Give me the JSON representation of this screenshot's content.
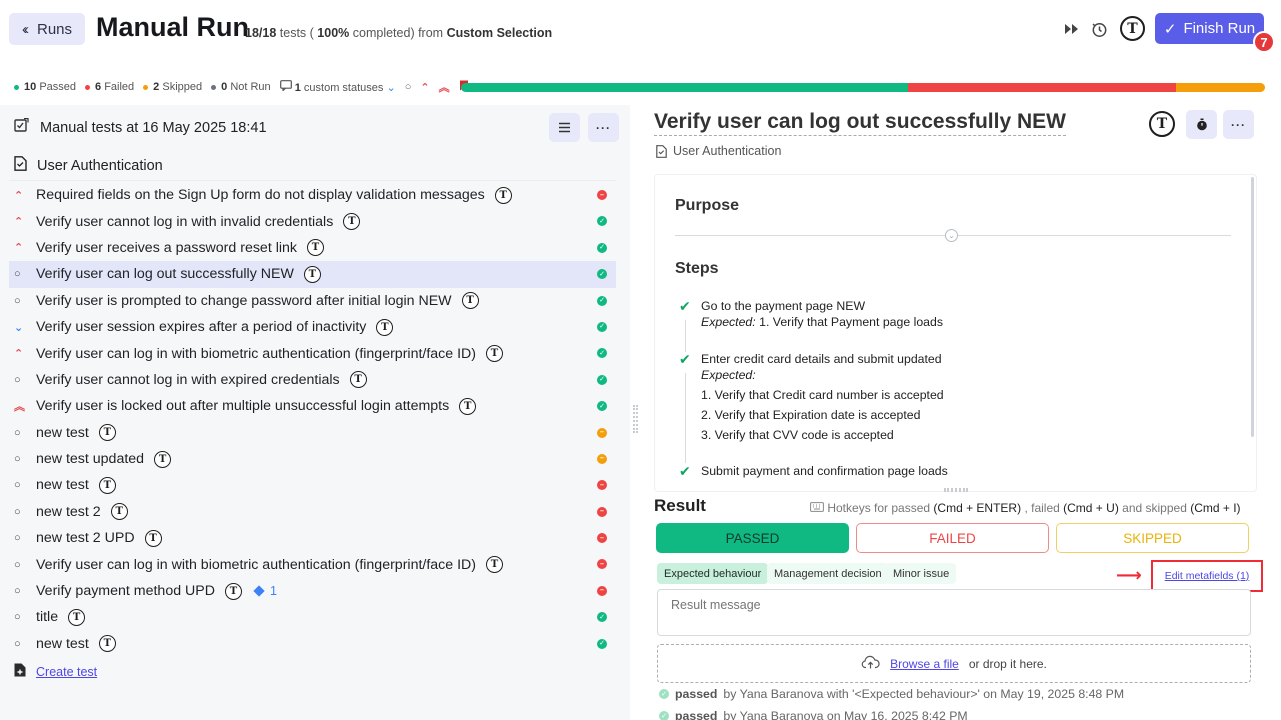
{
  "header": {
    "runs_label": "Runs",
    "title": "Manual Run",
    "count": "18/18",
    "tests_word": "tests (",
    "percent": "100%",
    "completed_from": "completed) from",
    "selection": "Custom Selection",
    "finish_label": "Finish Run",
    "notification_count": "7"
  },
  "stats": {
    "passed_count": "10",
    "passed_label": "Passed",
    "failed_count": "6",
    "failed_label": "Failed",
    "skipped_count": "2",
    "skipped_label": "Skipped",
    "notrun_count": "0",
    "notrun_label": "Not Run",
    "custom_count": "1",
    "custom_label": "custom statuses",
    "progress": {
      "passed": 10,
      "failed": 6,
      "skipped": 2,
      "not_run": 0
    }
  },
  "colors": {
    "passed": "#10b981",
    "failed": "#ef4444",
    "skipped": "#f59e0b",
    "notrun": "#6b7280",
    "accent": "#5a5de8"
  },
  "left": {
    "plan_title": "Manual tests at 16 May 2025 18:41",
    "suite_title": "User Authentication",
    "create_label": "Create test",
    "tests": [
      {
        "title": "Required fields on the Sign Up form do not display validation messages",
        "priority": "up",
        "status": "failed"
      },
      {
        "title": "Verify user cannot log in with invalid credentials",
        "priority": "up",
        "status": "passed"
      },
      {
        "title": "Verify user receives a password reset link",
        "priority": "up",
        "status": "passed"
      },
      {
        "title": "Verify user can log out successfully NEW",
        "priority": "none",
        "status": "passed",
        "active": true
      },
      {
        "title": "Verify user is prompted to change password after initial login NEW",
        "priority": "none",
        "status": "passed"
      },
      {
        "title": "Verify user session expires after a period of inactivity",
        "priority": "down",
        "status": "passed"
      },
      {
        "title": "Verify user can log in with biometric authentication (fingerprint/face ID)",
        "priority": "up",
        "status": "passed"
      },
      {
        "title": "Verify user cannot log in with expired credentials",
        "priority": "none",
        "status": "passed"
      },
      {
        "title": "Verify user is locked out after multiple unsuccessful login attempts",
        "priority": "dbl",
        "status": "passed"
      },
      {
        "title": "new test",
        "priority": "none",
        "status": "skipped"
      },
      {
        "title": "new test updated",
        "priority": "none",
        "status": "skipped"
      },
      {
        "title": "new test",
        "priority": "none",
        "status": "failed"
      },
      {
        "title": "new test 2",
        "priority": "none",
        "status": "failed"
      },
      {
        "title": "new test 2 UPD",
        "priority": "none",
        "status": "failed"
      },
      {
        "title": "Verify user can log in with biometric authentication (fingerprint/face ID)",
        "priority": "none",
        "status": "failed"
      },
      {
        "title": "Verify payment method UPD",
        "priority": "none",
        "status": "failed",
        "diamond": "1"
      },
      {
        "title": "title",
        "priority": "none",
        "status": "passed"
      },
      {
        "title": "new test",
        "priority": "none",
        "status": "passed"
      }
    ]
  },
  "detail": {
    "title": "Verify user can log out successfully NEW",
    "suite": "User Authentication",
    "purpose_label": "Purpose",
    "steps_label": "Steps",
    "expected_label": "Expected:",
    "step1": "Go to the payment page NEW",
    "step1_expected": "1. Verify that Payment page loads",
    "step2": "Enter credit card details and submit updated",
    "step2_e1": "1. Verify that Credit card number is accepted",
    "step2_e2": "2. Verify that Expiration date is accepted",
    "step2_e3": "3. Verify that CVV code is accepted",
    "step3": "Submit payment and confirmation page loads"
  },
  "result": {
    "label": "Result",
    "hotkeys_prefix": "Hotkeys for passed",
    "hk_passed": "(Cmd + ENTER)",
    "hk_mid1": ", failed",
    "hk_failed": "(Cmd + U)",
    "hk_mid2": "and skipped",
    "hk_skipped": "(Cmd + I)",
    "passed_label": "PASSED",
    "failed_label": "FAILED",
    "skipped_label": "SKIPPED",
    "tag1": "Expected behaviour",
    "tag2": "Management decision",
    "tag3": "Minor issue",
    "edit_metafields": "Edit metafields (1)",
    "message_placeholder": "Result message",
    "browse_label": "Browse a file",
    "drop_label": "or drop it here.",
    "h1_status": "passed",
    "h1_by": "by Yana Baranova with '<Expected behaviour>' on May 19, 2025 8:48 PM",
    "h2_status": "passed",
    "h2_by": "by Yana Baranova on May 16, 2025 8:42 PM"
  }
}
